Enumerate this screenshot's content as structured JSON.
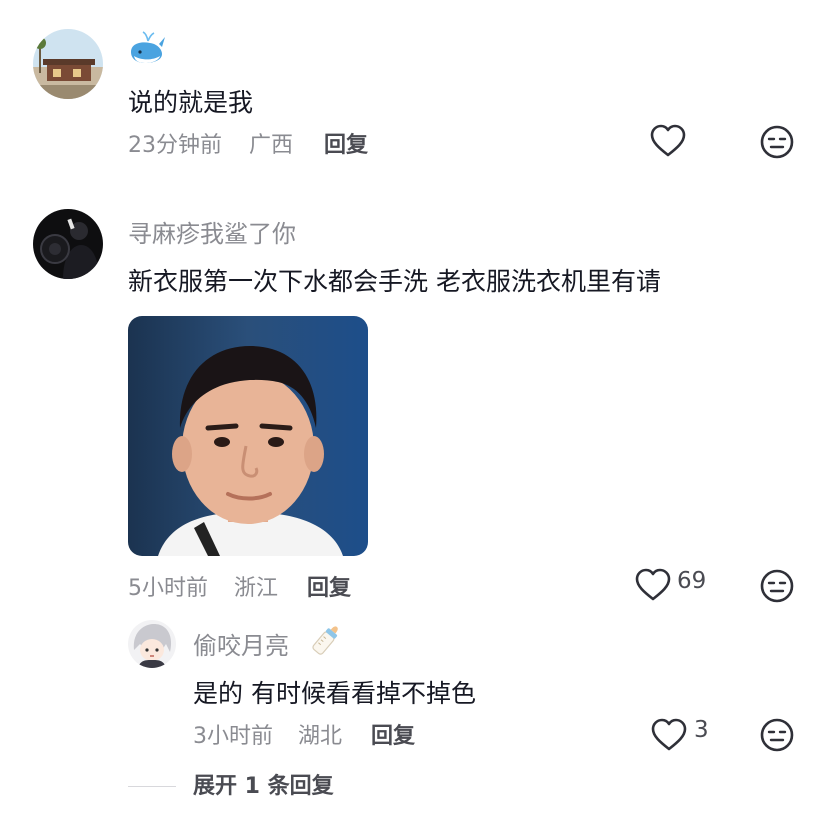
{
  "comments": [
    {
      "avatar": "house-photo-avatar",
      "username_emoji": "whale-emoji",
      "text": "说的就是我",
      "time": "23分钟前",
      "location": "广西",
      "reply_label": "回复",
      "like_count": ""
    },
    {
      "username": "寻麻疹我鲨了你",
      "text": "新衣服第一次下水都会手洗 老衣服洗衣机里有请",
      "image": "man-face-photo",
      "time": "5小时前",
      "location": "浙江",
      "reply_label": "回复",
      "like_count": "69"
    }
  ],
  "reply": {
    "username": "偷咬月亮",
    "username_emoji": "baby-bottle-emoji",
    "text": "是的  有时候看看掉不掉色",
    "time": "3小时前",
    "location": "湖北",
    "reply_label": "回复",
    "like_count": "3"
  },
  "expand_label": "展开 1 条回复",
  "icons": {
    "like": "heart-outline-icon",
    "dislike": "neutral-face-icon"
  },
  "colors": {
    "text_primary": "#161823",
    "text_secondary": "#8a8b91",
    "icon": "#2f3038"
  }
}
